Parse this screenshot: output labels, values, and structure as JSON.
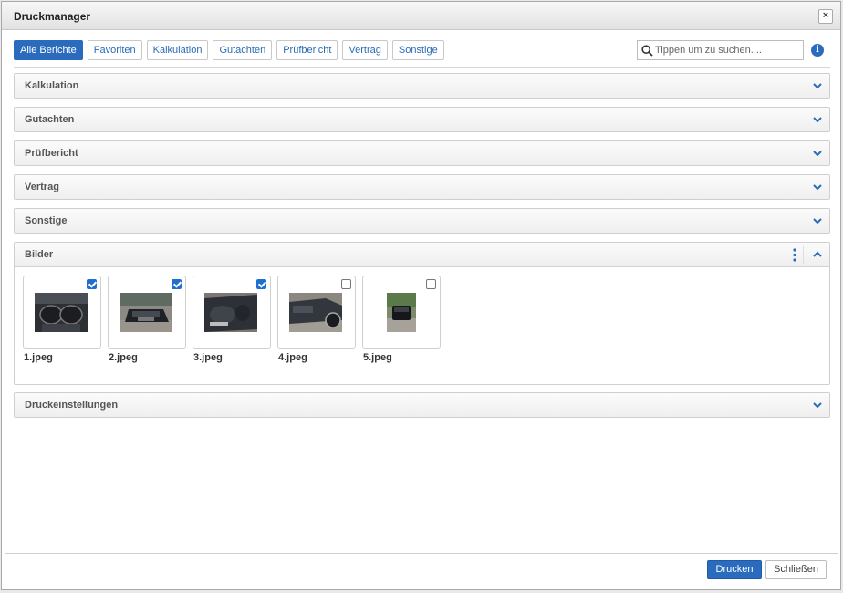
{
  "dialog": {
    "title": "Druckmanager",
    "close_label": "×"
  },
  "filters": [
    {
      "label": "Alle Berichte",
      "active": true
    },
    {
      "label": "Favoriten",
      "active": false
    },
    {
      "label": "Kalkulation",
      "active": false
    },
    {
      "label": "Gutachten",
      "active": false
    },
    {
      "label": "Prüfbericht",
      "active": false
    },
    {
      "label": "Vertrag",
      "active": false
    },
    {
      "label": "Sonstige",
      "active": false
    }
  ],
  "search": {
    "placeholder": "Tippen um zu suchen....",
    "value": ""
  },
  "info_glyph": "i",
  "sections": {
    "kalkulation": "Kalkulation",
    "gutachten": "Gutachten",
    "pruefbericht": "Prüfbericht",
    "vertrag": "Vertrag",
    "sonstige": "Sonstige",
    "bilder": "Bilder",
    "druckeinstellungen": "Druckeinstellungen"
  },
  "images": [
    {
      "name": "1.jpeg",
      "checked": true
    },
    {
      "name": "2.jpeg",
      "checked": true
    },
    {
      "name": "3.jpeg",
      "checked": true
    },
    {
      "name": "4.jpeg",
      "checked": false
    },
    {
      "name": "5.jpeg",
      "checked": false
    }
  ],
  "footer": {
    "print_label": "Drucken",
    "close_label": "Schließen"
  },
  "colors": {
    "accent": "#2a6bbd",
    "checkbox_checked": "#1f6fd1"
  }
}
